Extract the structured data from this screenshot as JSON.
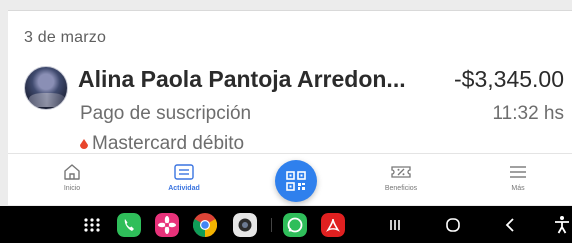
{
  "activity": {
    "date_header": "3 de marzo",
    "transaction": {
      "name": "Alina Paola Pantoja Arredon...",
      "amount": "-$3,345.00",
      "description": "Pago de suscripción",
      "time": "11:32 hs",
      "payment_method": "Mastercard débito"
    }
  },
  "bottom_nav": {
    "items": [
      {
        "label": "Inicio",
        "icon": "home-icon"
      },
      {
        "label": "Actividad",
        "icon": "activity-list-icon",
        "active": true
      },
      {
        "label": "",
        "icon": "qr-code-icon"
      },
      {
        "label": "Beneficios",
        "icon": "discount-ticket-icon"
      },
      {
        "label": "Más",
        "icon": "menu-icon"
      }
    ]
  },
  "system_bar": {
    "icons": [
      "app-drawer-icon",
      "phone-icon",
      "photos-icon",
      "chrome-icon",
      "camera-icon",
      "whatsapp-icon",
      "pdf-reader-icon",
      "recents-icon",
      "home-circle-icon",
      "back-icon",
      "accessibility-icon"
    ]
  },
  "colors": {
    "accent": "#3a74e0",
    "fab": "#2f80ed",
    "text_primary": "#2b2b2b",
    "text_secondary": "#6d6d6d"
  }
}
